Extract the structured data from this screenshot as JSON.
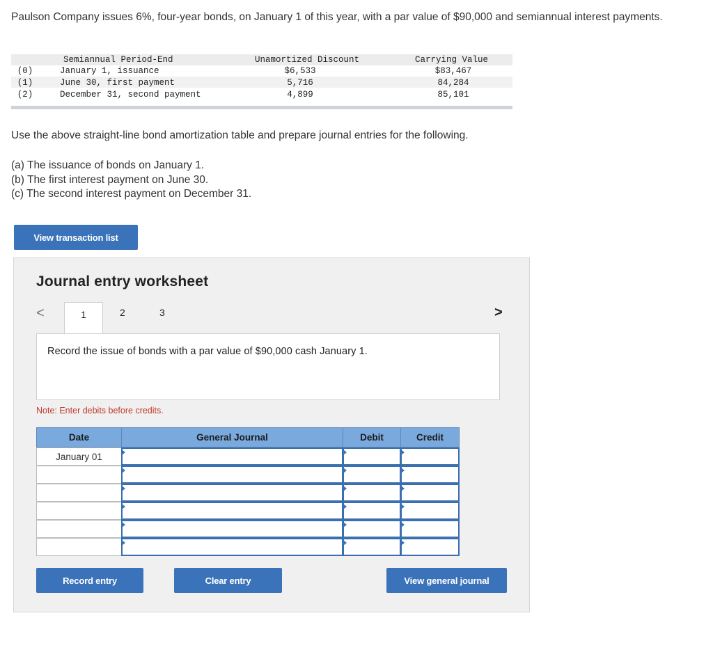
{
  "intro": "Paulson Company issues 6%, four-year bonds, on January 1 of this year, with a par value of $90,000 and semiannual interest payments.",
  "amortization_table": {
    "headers": {
      "period": "Semiannual Period-End",
      "discount": "Unamortized Discount",
      "carrying": "Carrying Value"
    },
    "rows": [
      {
        "idx": "(0)",
        "period": "January 1, issuance",
        "discount": "$6,533",
        "carrying": "$83,467"
      },
      {
        "idx": "(1)",
        "period": "June 30, first payment",
        "discount": "5,716",
        "carrying": "84,284"
      },
      {
        "idx": "(2)",
        "period": "December 31, second payment",
        "discount": "4,899",
        "carrying": "85,101"
      }
    ]
  },
  "instruction": "Use the above straight-line bond amortization table and prepare journal entries for the following.",
  "tasks": [
    "(a) The issuance of bonds on January 1.",
    "(b) The first interest payment on June 30.",
    "(c) The second interest payment on December 31."
  ],
  "view_transaction_list_label": "View transaction list",
  "worksheet": {
    "title": "Journal entry worksheet",
    "prev_icon": "<",
    "next_icon": ">",
    "tabs": [
      "1",
      "2",
      "3"
    ],
    "active_tab": "1",
    "description": "Record the issue of bonds with a par value of $90,000 cash January 1.",
    "note": "Note: Enter debits before credits.",
    "columns": {
      "date": "Date",
      "journal": "General Journal",
      "debit": "Debit",
      "credit": "Credit"
    },
    "rows": [
      {
        "date": "January 01"
      },
      {
        "date": ""
      },
      {
        "date": ""
      },
      {
        "date": ""
      },
      {
        "date": ""
      },
      {
        "date": ""
      }
    ],
    "record_label": "Record entry",
    "clear_label": "Clear entry",
    "view_journal_label": "View general journal"
  }
}
